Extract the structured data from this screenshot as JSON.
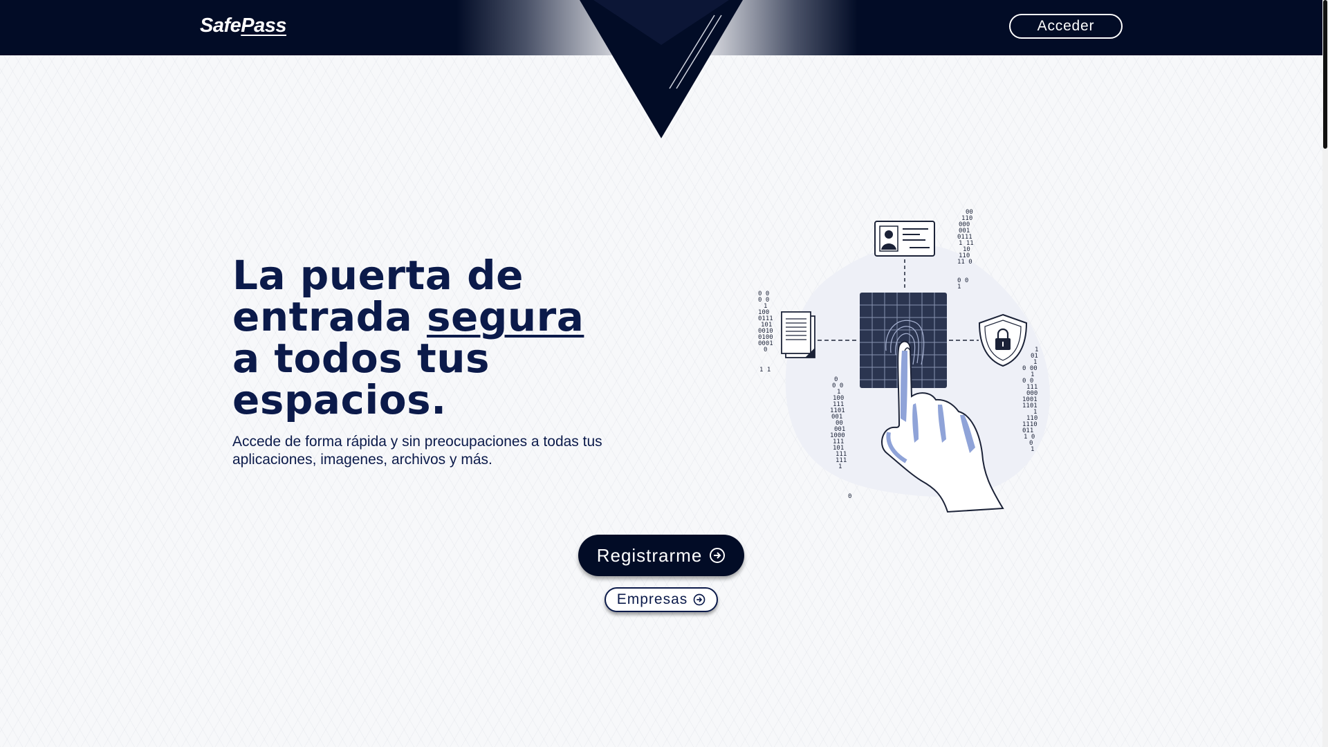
{
  "header": {
    "logo_safe": "Safe",
    "logo_pass": "Pass",
    "login_label": "Acceder"
  },
  "hero": {
    "headline_line1": "La puerta de",
    "headline_line2_pre": "entrada ",
    "headline_highlight": "segura",
    "headline_line3": "a todos tus",
    "headline_line4": "espacios.",
    "subtext": "Accede de forma rápida y sin preocupaciones a todas tus aplicaciones, imagenes, archivos y más."
  },
  "actions": {
    "register_label": "Registrarme",
    "business_label": "Empresas"
  },
  "illustration": {
    "binary_left": [
      "0 0",
      "0 0",
      "1",
      "100",
      "0111",
      "101",
      "0010",
      "0100",
      "0001",
      "0",
      "1 1"
    ],
    "binary_mid": [
      "0",
      "0 0",
      "1",
      "100",
      "111",
      "1101",
      "001",
      "00",
      "001",
      "1000",
      "111",
      "101",
      "111",
      "111",
      "1",
      "0"
    ],
    "binary_top": [
      "00",
      "110",
      "000",
      "001",
      "0111",
      "1 11",
      "10",
      "110",
      "11 0",
      "0 0",
      "1"
    ],
    "binary_right": [
      "1",
      "01",
      "1",
      "0 00",
      "1",
      "0 0",
      "111",
      "000",
      "1001",
      "1101",
      "1",
      "110",
      "1110",
      "011",
      "1 0",
      "0",
      "1"
    ]
  },
  "colors": {
    "navy": "#020c26",
    "headline": "#0b1a4a",
    "accent_blue": "#8fa3d8"
  },
  "icons": [
    "enter-icon",
    "fingerprint-icon",
    "id-card-icon",
    "document-icon",
    "shield-lock-icon"
  ]
}
